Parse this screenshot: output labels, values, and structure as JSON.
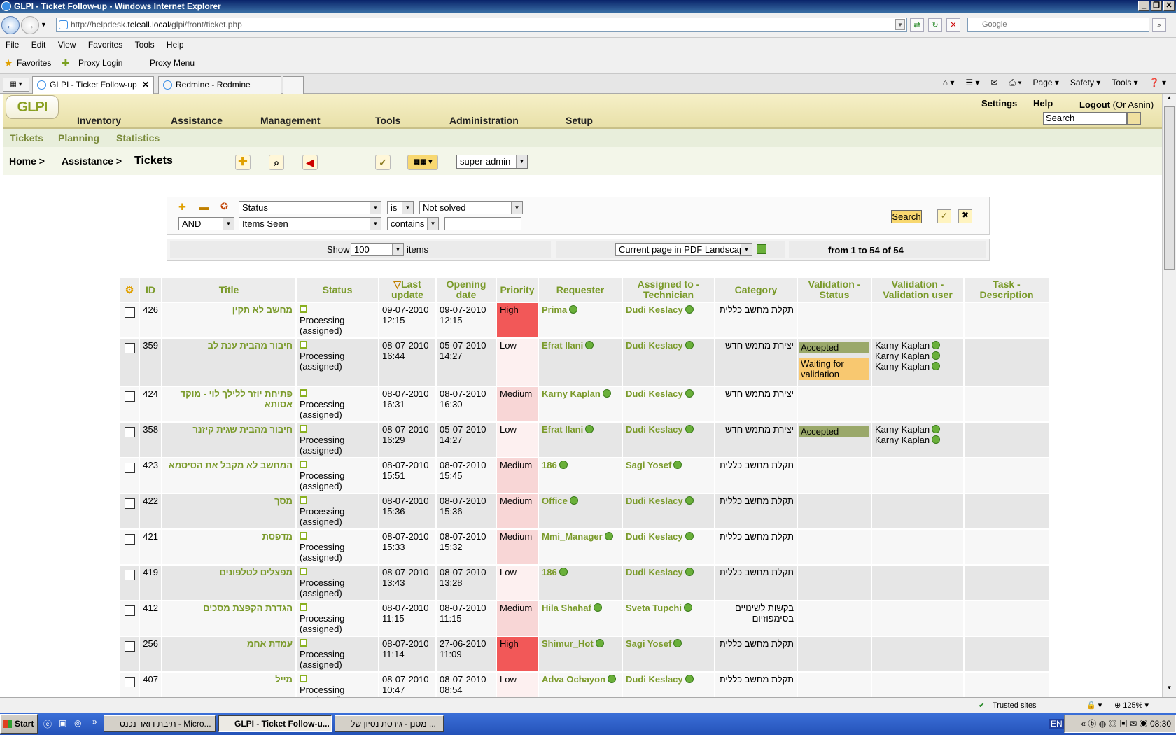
{
  "window": {
    "title": "GLPI - Ticket Follow-up - Windows Internet Explorer"
  },
  "browser": {
    "address_prefix": "http://helpdesk.",
    "address_domain": "teleall.local",
    "address_path": "/glpi/front/ticket.php",
    "search_placeholder": "Google",
    "menu": [
      "File",
      "Edit",
      "View",
      "Favorites",
      "Tools",
      "Help"
    ],
    "favorites_label": "Favorites",
    "favorite_links": [
      "Proxy Login",
      "Proxy Menu"
    ],
    "tabs": [
      {
        "label": "GLPI - Ticket Follow-up",
        "active": true
      },
      {
        "label": "Redmine - Redmine",
        "active": false
      }
    ],
    "command_bar": [
      "Page",
      "Safety",
      "Tools"
    ]
  },
  "glpi": {
    "logo": "GLPI",
    "main_menu": [
      "Inventory",
      "Assistance",
      "Management",
      "Tools",
      "Administration",
      "Setup"
    ],
    "top_links": {
      "settings": "Settings",
      "help": "Help",
      "logout": "Logout",
      "user": "(Or Asnin)"
    },
    "global_search_placeholder": "Search",
    "sub_menu": [
      "Tickets",
      "Planning",
      "Statistics"
    ],
    "breadcrumb": [
      "Home >",
      "Assistance >",
      "Tickets"
    ],
    "profile": "super-admin"
  },
  "search": {
    "row1": {
      "field": "Status",
      "operator": "is",
      "value": "Not solved"
    },
    "row2": {
      "link": "AND",
      "field": "Items Seen",
      "operator": "contains",
      "value": ""
    },
    "button": "Search"
  },
  "pager": {
    "show_label": "Show",
    "per_page": "100",
    "items_label": "items",
    "export": "Current page in PDF Landscape",
    "range_prefix": "from",
    "range_start": "1",
    "range_to": "to",
    "range_end": "54",
    "range_of": "of",
    "range_total": "54"
  },
  "table": {
    "headers": [
      "ID",
      "Title",
      "Status",
      "Last update",
      "Opening date",
      "Priority",
      "Requester",
      "Assigned to - Technician",
      "Category",
      "Validation - Status",
      "Validation - Validation user",
      "Task - Description"
    ],
    "rows": [
      {
        "id": "426",
        "title": "מחשב לא תקין",
        "status": "Processing (assigned)",
        "last_update": "09-07-2010 12:15",
        "opening": "09-07-2010 12:15",
        "priority": "High",
        "requester": "Prima",
        "technician": "Dudi Keslacy",
        "category": "תקלת מחשב כללית",
        "validation": [],
        "validators": []
      },
      {
        "id": "359",
        "title": "חיבור מהבית ענת לב",
        "status": "Processing (assigned)",
        "last_update": "08-07-2010 16:44",
        "opening": "05-07-2010 14:27",
        "priority": "Low",
        "requester": "Efrat Ilani",
        "technician": "Dudi Keslacy",
        "category": "יצירת מתמש חדש",
        "validation": [
          "Accepted",
          "Waiting for validation"
        ],
        "validators": [
          "Karny Kaplan",
          "Karny Kaplan",
          "Karny Kaplan"
        ]
      },
      {
        "id": "424",
        "title": "פתיחת יוזר ללילך לוי - מוקד אסותא",
        "status": "Processing (assigned)",
        "last_update": "08-07-2010 16:31",
        "opening": "08-07-2010 16:30",
        "priority": "Medium",
        "requester": "Karny Kaplan",
        "technician": "Dudi Keslacy",
        "category": "יצירת מתמש חדש",
        "validation": [],
        "validators": []
      },
      {
        "id": "358",
        "title": "חיבור מהבית שגית קיזנר",
        "status": "Processing (assigned)",
        "last_update": "08-07-2010 16:29",
        "opening": "05-07-2010 14:27",
        "priority": "Low",
        "requester": "Efrat Ilani",
        "technician": "Dudi Keslacy",
        "category": "יצירת מתמש חדש",
        "validation": [
          "Accepted"
        ],
        "validators": [
          "Karny Kaplan",
          "Karny Kaplan"
        ]
      },
      {
        "id": "423",
        "title": "המחשב לא מקבל את הסיסמא",
        "status": "Processing (assigned)",
        "last_update": "08-07-2010 15:51",
        "opening": "08-07-2010 15:45",
        "priority": "Medium",
        "requester": "186",
        "technician": "Sagi Yosef",
        "category": "תקלת מחשב כללית",
        "validation": [],
        "validators": []
      },
      {
        "id": "422",
        "title": "מסך",
        "status": "Processing (assigned)",
        "last_update": "08-07-2010 15:36",
        "opening": "08-07-2010 15:36",
        "priority": "Medium",
        "requester": "Office",
        "technician": "Dudi Keslacy",
        "category": "תקלת מחשב כללית",
        "validation": [],
        "validators": []
      },
      {
        "id": "421",
        "title": "מדפסת",
        "status": "Processing (assigned)",
        "last_update": "08-07-2010 15:33",
        "opening": "08-07-2010 15:32",
        "priority": "Medium",
        "requester": "Mmi_Manager",
        "technician": "Dudi Keslacy",
        "category": "תקלת מחשב כללית",
        "validation": [],
        "validators": []
      },
      {
        "id": "419",
        "title": "מפצלים לטלפונים",
        "status": "Processing (assigned)",
        "last_update": "08-07-2010 13:43",
        "opening": "08-07-2010 13:28",
        "priority": "Low",
        "requester": "186",
        "technician": "Dudi Keslacy",
        "category": "תקלת מחשב כללית",
        "validation": [],
        "validators": []
      },
      {
        "id": "412",
        "title": "הגדרת הקפצת מסכים",
        "status": "Processing (assigned)",
        "last_update": "08-07-2010 11:15",
        "opening": "08-07-2010 11:15",
        "priority": "Medium",
        "requester": "Hila Shahaf",
        "technician": "Sveta Tupchi",
        "category": "בקשות לשינויים בסימפוזיום",
        "validation": [],
        "validators": []
      },
      {
        "id": "256",
        "title": "עמדת אחמ",
        "status": "Processing (assigned)",
        "last_update": "08-07-2010 11:14",
        "opening": "27-06-2010 11:09",
        "priority": "High",
        "requester": "Shimur_Hot",
        "technician": "Sagi Yosef",
        "category": "תקלת מחשב כללית",
        "validation": [],
        "validators": []
      },
      {
        "id": "407",
        "title": "מייל",
        "status": "Processing (assigned)",
        "last_update": "08-07-2010 10:47",
        "opening": "08-07-2010 08:54",
        "priority": "Low",
        "requester": "Adva Ochayon",
        "technician": "Dudi Keslacy",
        "category": "תקלת מחשב כללית",
        "validation": [],
        "validators": []
      }
    ]
  },
  "statusbar": {
    "zone": "Trusted sites",
    "zoom": "125%"
  },
  "taskbar": {
    "start": "Start",
    "tasks": [
      {
        "label": "תיבת דואר נכנס - Micro...",
        "active": false
      },
      {
        "label": "GLPI - Ticket Follow-u...",
        "active": true
      },
      {
        "label": "מסנן - גירסת נסיון של ...",
        "active": false
      }
    ],
    "lang": "EN",
    "clock": "08:30"
  }
}
